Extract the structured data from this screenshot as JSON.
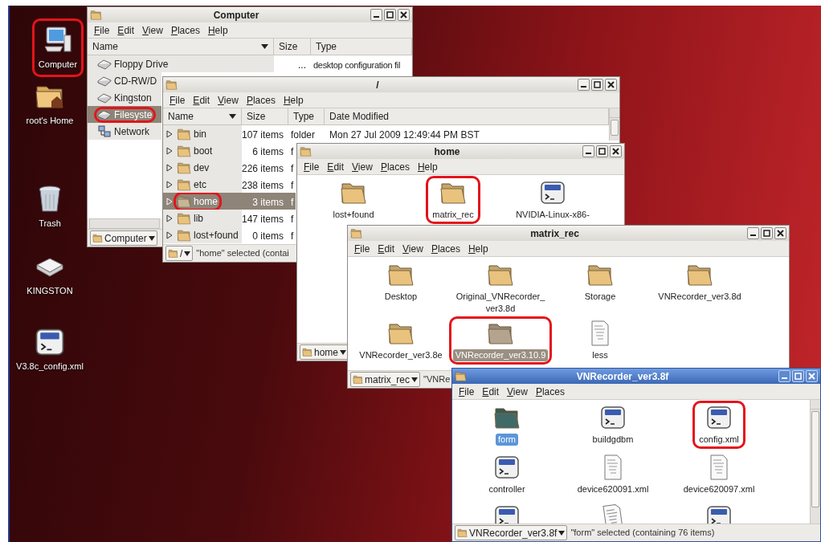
{
  "desktop": {
    "icons": [
      {
        "label": "Computer",
        "kind": "computer",
        "highlighted": true
      },
      {
        "label": "root's Home",
        "kind": "home",
        "highlighted": false
      },
      {
        "label": "Trash",
        "kind": "trash",
        "highlighted": false
      },
      {
        "label": "KINGSTON",
        "kind": "usb",
        "highlighted": false
      },
      {
        "label": "V3.8c_config.xml",
        "kind": "script",
        "highlighted": false
      }
    ]
  },
  "windows": [
    {
      "kind": "list",
      "title": "Computer",
      "active": false,
      "menu": [
        "File",
        "Edit",
        "View",
        "Places",
        "Help"
      ],
      "columns": [
        "Name",
        "Size",
        "Type"
      ],
      "rows": [
        {
          "name": "Floppy Drive",
          "kind": "drive",
          "size": "...",
          "type": "desktop configuration fil",
          "selected": false,
          "highlighted": false
        },
        {
          "name": "CD-RW/D",
          "kind": "drive",
          "selected": false,
          "highlighted": false
        },
        {
          "name": "Kingston",
          "kind": "drive",
          "selected": false,
          "highlighted": false
        },
        {
          "name": "Filesyste",
          "kind": "drive",
          "selected": true,
          "highlighted": true
        },
        {
          "name": "Network",
          "kind": "network",
          "selected": false,
          "highlighted": false
        }
      ],
      "location": "Computer"
    },
    {
      "kind": "list",
      "title": "/",
      "active": false,
      "menu": [
        "File",
        "Edit",
        "View",
        "Places",
        "Help"
      ],
      "columns": [
        "Name",
        "Size",
        "Type",
        "Date Modified"
      ],
      "rows": [
        {
          "name": "bin",
          "kind": "folder",
          "size": "107 items",
          "type": "folder",
          "date": "Mon 27 Jul 2009 12:49:44 PM BST",
          "selected": false,
          "highlighted": false
        },
        {
          "name": "boot",
          "kind": "folder",
          "size": "6 items",
          "type": "f",
          "selected": false,
          "highlighted": false
        },
        {
          "name": "dev",
          "kind": "folder",
          "size": "226 items",
          "type": "f",
          "selected": false,
          "highlighted": false
        },
        {
          "name": "etc",
          "kind": "folder",
          "size": "238 items",
          "type": "f",
          "selected": false,
          "highlighted": false
        },
        {
          "name": "home",
          "kind": "folder",
          "size": "3 items",
          "type": "f",
          "selected": true,
          "highlighted": true
        },
        {
          "name": "lib",
          "kind": "folder",
          "size": "147 items",
          "type": "f",
          "selected": false,
          "highlighted": false
        },
        {
          "name": "lost+found",
          "kind": "folder",
          "size": "0 items",
          "type": "f",
          "selected": false,
          "highlighted": false
        }
      ],
      "location": "/",
      "status": "\"home\" selected (contai"
    },
    {
      "kind": "grid",
      "title": "home",
      "active": false,
      "menu": [
        "File",
        "Edit",
        "View",
        "Places",
        "Help"
      ],
      "items": [
        {
          "label": "lost+found",
          "kind": "folder",
          "selected": false,
          "highlighted": false
        },
        {
          "label": "matrix_rec",
          "kind": "folder",
          "selected": false,
          "highlighted": true
        },
        {
          "label": "NVIDIA-Linux-x86-",
          "kind": "script",
          "selected": false,
          "highlighted": false
        }
      ],
      "location": "home"
    },
    {
      "kind": "grid",
      "title": "matrix_rec",
      "active": false,
      "menu": [
        "File",
        "Edit",
        "View",
        "Places",
        "Help"
      ],
      "items": [
        {
          "label": "Desktop",
          "kind": "folder",
          "selected": false,
          "highlighted": false
        },
        {
          "label": "Original_VNRecorder_ver3.8d",
          "kind": "folder",
          "selected": false,
          "highlighted": false
        },
        {
          "label": "Storage",
          "kind": "folder",
          "selected": false,
          "highlighted": false
        },
        {
          "label": "VNRecorder_ver3.8d",
          "kind": "folder",
          "selected": false,
          "highlighted": false
        },
        {
          "label": "VNRecorder_ver3.8e",
          "kind": "folder",
          "selected": false,
          "highlighted": false
        },
        {
          "label": "VNRecorder_ver3.10.9",
          "kind": "folder",
          "selected": true,
          "highlighted": true
        },
        {
          "label": "less",
          "kind": "table",
          "selected": false,
          "highlighted": false
        }
      ],
      "location": "matrix_rec",
      "status": "\"VNRe"
    },
    {
      "kind": "grid",
      "title": "VNRecorder_ver3.8f",
      "active": true,
      "menu": [
        "File",
        "Edit",
        "View",
        "Places"
      ],
      "items": [
        {
          "label": "form",
          "kind": "folder",
          "selected": true,
          "highlighted": false
        },
        {
          "label": "buildgdbm",
          "kind": "script",
          "selected": false,
          "highlighted": false
        },
        {
          "label": "config.xml",
          "kind": "script",
          "selected": false,
          "highlighted": true
        },
        {
          "label": "controller",
          "kind": "script",
          "selected": false,
          "highlighted": false
        },
        {
          "label": "device620091.xml",
          "kind": "xml",
          "selected": false,
          "highlighted": false
        },
        {
          "label": "device620097.xml",
          "kind": "xml",
          "selected": false,
          "highlighted": false
        },
        {
          "kind": "script",
          "selected": false,
          "highlighted": false
        },
        {
          "kind": "document",
          "selected": false,
          "highlighted": false
        },
        {
          "kind": "script",
          "selected": false,
          "highlighted": false
        }
      ],
      "location": "VNRecorder_ver3.8f",
      "status": "\"form\" selected (containing 76 items)"
    }
  ]
}
